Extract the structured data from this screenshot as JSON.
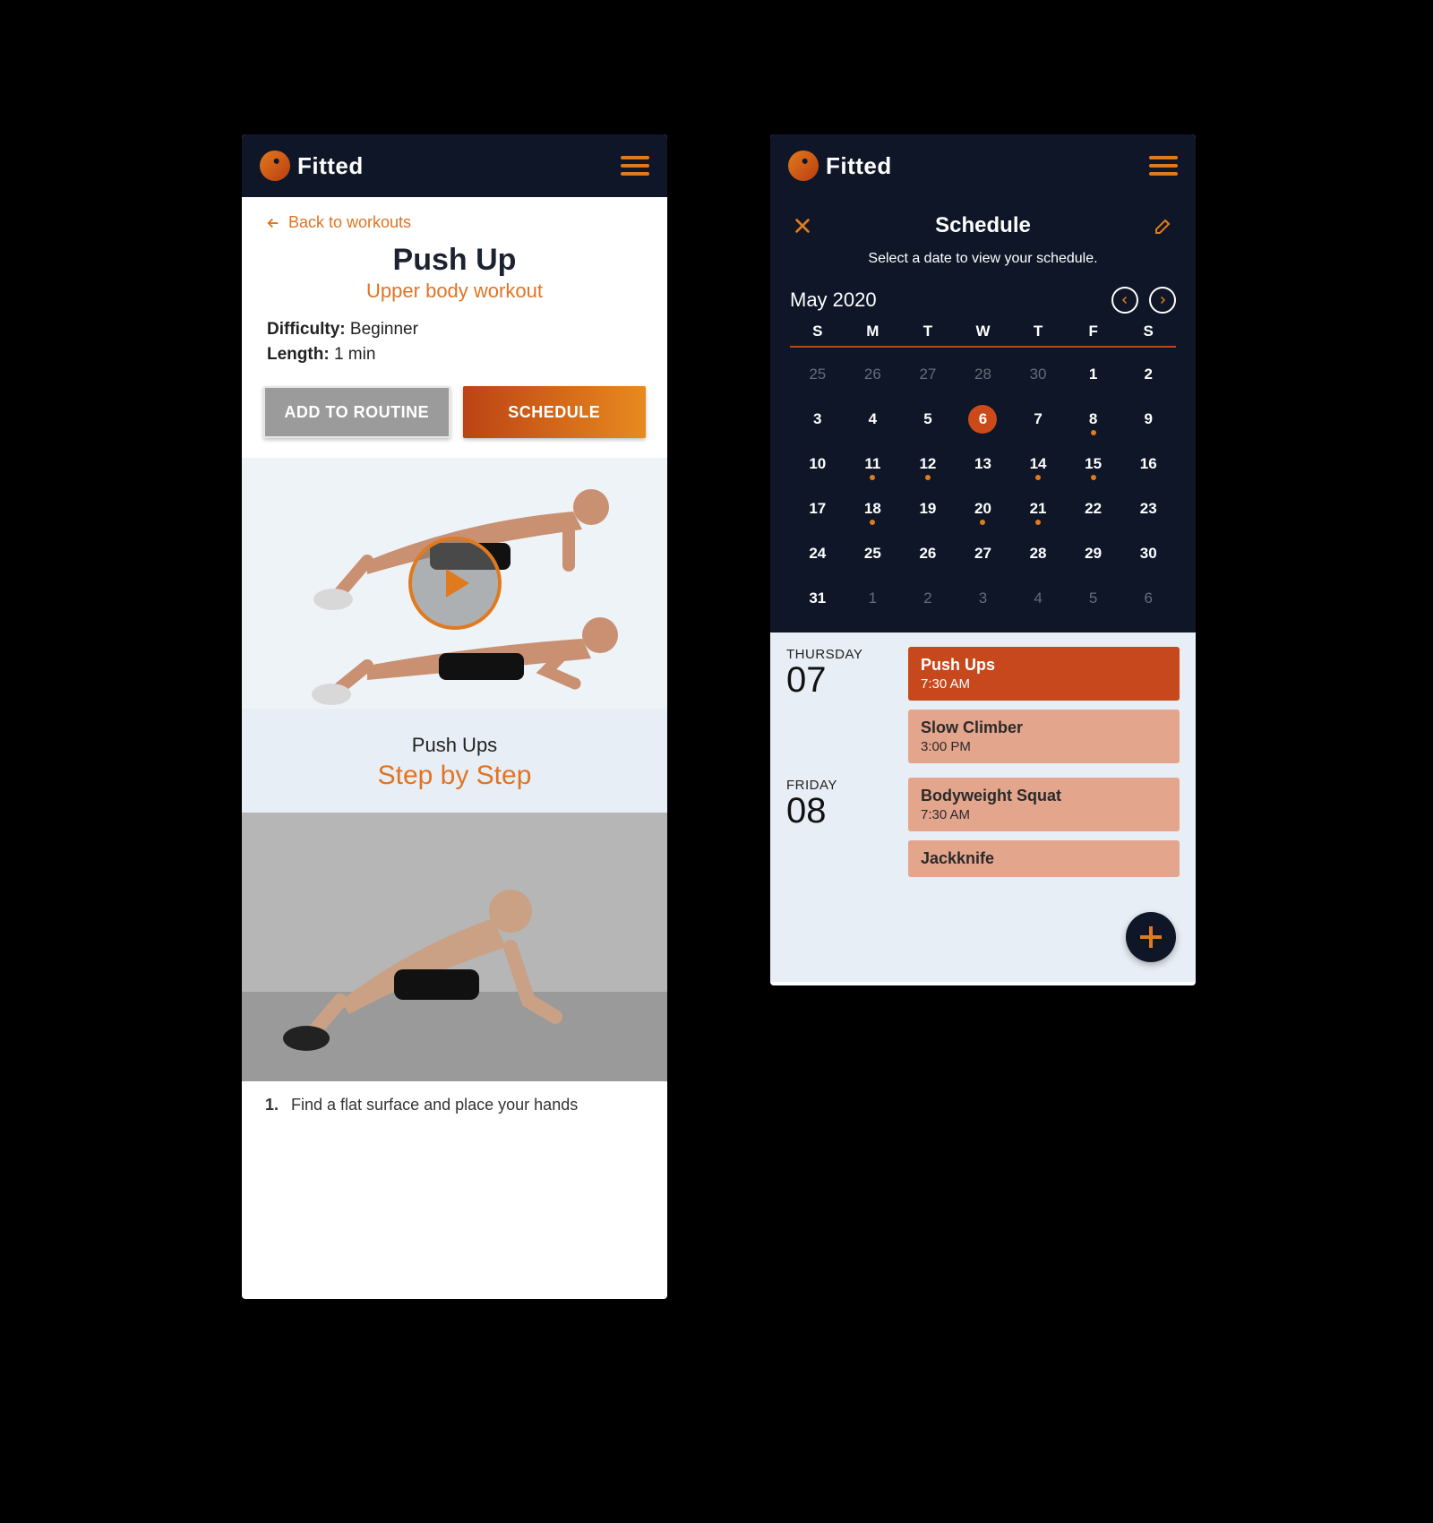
{
  "brand": {
    "name": "Fitted"
  },
  "left": {
    "back_label": "Back to workouts",
    "title": "Push Up",
    "subtitle": "Upper body workout",
    "difficulty_label": "Difficulty:",
    "difficulty_value": "Beginner",
    "length_label": "Length:",
    "length_value": "1 min",
    "add_routine": "ADD TO ROUTINE",
    "schedule": "SCHEDULE",
    "step_head_small": "Push Ups",
    "step_head_big": "Step by Step",
    "step1_num": "1.",
    "step1_text": "Find a flat surface and place your hands"
  },
  "right": {
    "title": "Schedule",
    "subtitle": "Select a date to view your schedule.",
    "month": "May 2020",
    "dow": [
      "S",
      "M",
      "T",
      "W",
      "T",
      "F",
      "S"
    ],
    "grid": [
      {
        "n": "25",
        "dim": true
      },
      {
        "n": "26",
        "dim": true
      },
      {
        "n": "27",
        "dim": true
      },
      {
        "n": "28",
        "dim": true
      },
      {
        "n": "30",
        "dim": true
      },
      {
        "n": "1"
      },
      {
        "n": "2"
      },
      {
        "n": "3"
      },
      {
        "n": "4"
      },
      {
        "n": "5"
      },
      {
        "n": "6",
        "sel": true
      },
      {
        "n": "7"
      },
      {
        "n": "8",
        "dot": true
      },
      {
        "n": "9"
      },
      {
        "n": "10"
      },
      {
        "n": "11",
        "dot": true
      },
      {
        "n": "12",
        "dot": true
      },
      {
        "n": "13"
      },
      {
        "n": "14",
        "dot": true
      },
      {
        "n": "15",
        "dot": true
      },
      {
        "n": "16"
      },
      {
        "n": "17"
      },
      {
        "n": "18",
        "dot": true
      },
      {
        "n": "19"
      },
      {
        "n": "20",
        "dot": true
      },
      {
        "n": "21",
        "dot": true
      },
      {
        "n": "22"
      },
      {
        "n": "23"
      },
      {
        "n": "24"
      },
      {
        "n": "25"
      },
      {
        "n": "26"
      },
      {
        "n": "27"
      },
      {
        "n": "28"
      },
      {
        "n": "29"
      },
      {
        "n": "30"
      },
      {
        "n": "31"
      },
      {
        "n": "1",
        "dim": true
      },
      {
        "n": "2",
        "dim": true
      },
      {
        "n": "3",
        "dim": true
      },
      {
        "n": "4",
        "dim": true
      },
      {
        "n": "5",
        "dim": true
      },
      {
        "n": "6",
        "dim": true
      }
    ],
    "agenda": [
      {
        "day_name": "THURSDAY",
        "day_num": "07",
        "events": [
          {
            "name": "Push Ups",
            "time": "7:30 AM",
            "style": "active"
          },
          {
            "name": "Slow Climber",
            "time": "3:00 PM",
            "style": "muted"
          }
        ]
      },
      {
        "day_name": "FRIDAY",
        "day_num": "08",
        "events": [
          {
            "name": "Bodyweight Squat",
            "time": "7:30 AM",
            "style": "muted"
          },
          {
            "name": "Jackknife",
            "time": "",
            "style": "muted"
          }
        ]
      }
    ]
  }
}
